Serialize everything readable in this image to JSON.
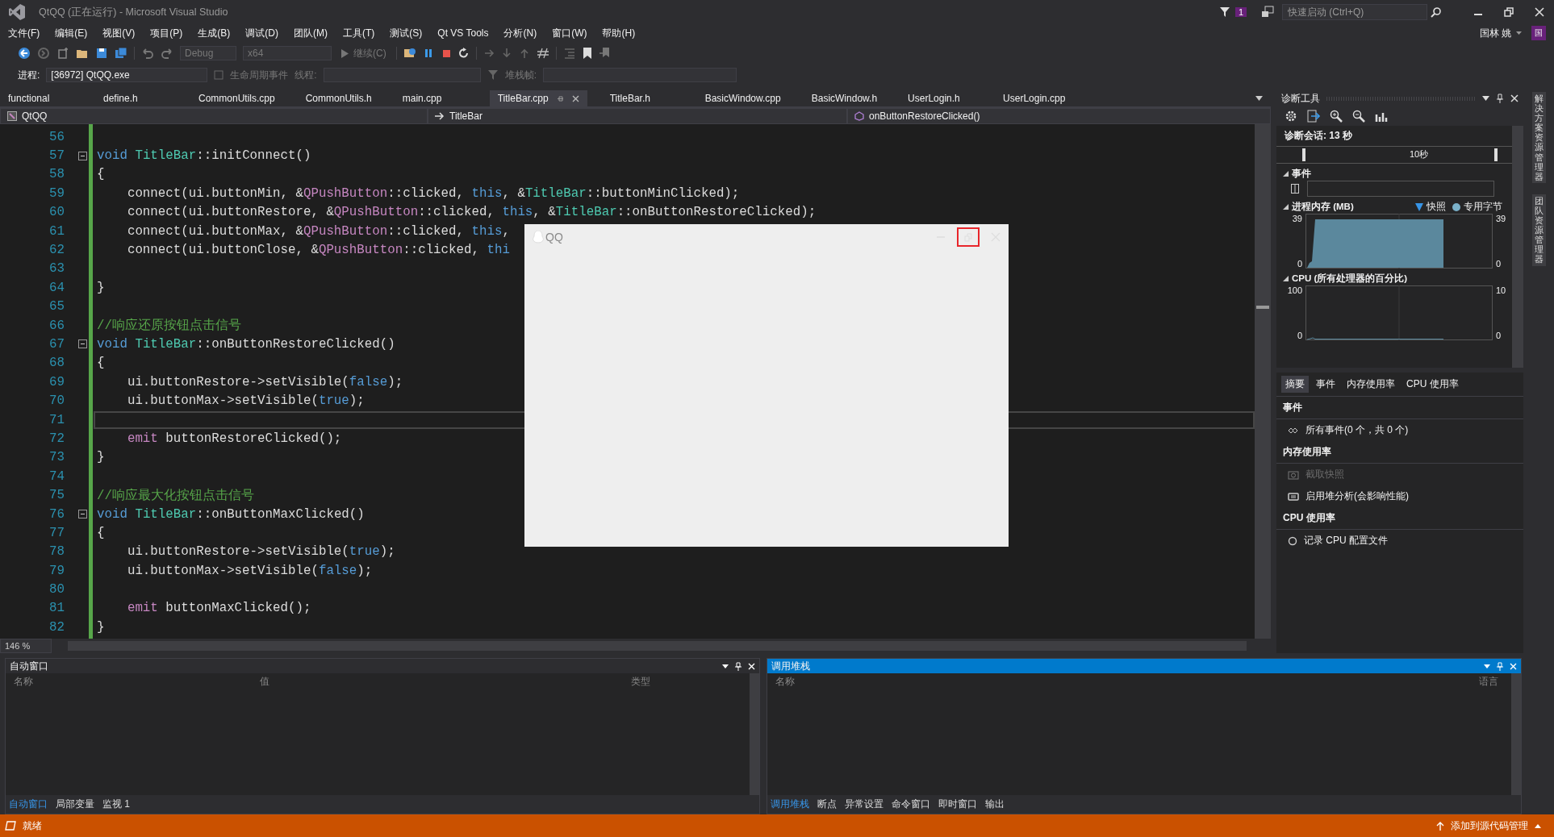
{
  "window": {
    "title": "QtQQ (正在运行) - Microsoft Visual Studio",
    "notification_count": "1",
    "quick_launch": {
      "placeholder": "快速启动 (Ctrl+Q)"
    },
    "user": "国林 姚",
    "avatar": "国"
  },
  "menu": [
    "文件(F)",
    "编辑(E)",
    "视图(V)",
    "项目(P)",
    "生成(B)",
    "调试(D)",
    "团队(M)",
    "工具(T)",
    "测试(S)",
    "Qt VS Tools",
    "分析(N)",
    "窗口(W)",
    "帮助(H)"
  ],
  "toolbar": {
    "configuration": "Debug",
    "platform": "x64",
    "continue": "继续(C)"
  },
  "debug_location": {
    "process_label": "进程:",
    "process": "[36972] QtQQ.exe",
    "lifecycle": "生命周期事件",
    "thread_label": "线程:",
    "stack_frame_label": "堆栈帧:"
  },
  "editor": {
    "tabs": [
      {
        "label": "functional",
        "selected": false
      },
      {
        "label": "define.h",
        "selected": false
      },
      {
        "label": "CommonUtils.cpp",
        "selected": false
      },
      {
        "label": "CommonUtils.h",
        "selected": false
      },
      {
        "label": "main.cpp",
        "selected": false
      },
      {
        "label": "TitleBar.cpp",
        "selected": true
      },
      {
        "label": "TitleBar.h",
        "selected": false
      },
      {
        "label": "BasicWindow.cpp",
        "selected": false
      },
      {
        "label": "BasicWindow.h",
        "selected": false
      },
      {
        "label": "UserLogin.h",
        "selected": false
      },
      {
        "label": "UserLogin.cpp",
        "selected": false
      }
    ],
    "nav": {
      "project": "QtQQ",
      "scope": "TitleBar",
      "member": "onButtonRestoreClicked()"
    },
    "lines": [
      {
        "number": "56",
        "collapsible": false,
        "current": false
      },
      {
        "number": "57",
        "collapsible": true,
        "current": false,
        "tokens": [
          {
            "kind": "keyword",
            "text": "void "
          },
          {
            "kind": "type",
            "text": "TitleBar"
          },
          {
            "kind": "plain",
            "text": "::initConnect()"
          }
        ]
      },
      {
        "number": "58",
        "collapsible": false,
        "current": false,
        "tokens": [
          {
            "kind": "plain",
            "text": "{"
          }
        ]
      },
      {
        "number": "59",
        "collapsible": false,
        "current": false,
        "indented": true,
        "tokens": [
          {
            "kind": "plain",
            "text": "connect(ui.buttonMin, &"
          },
          {
            "kind": "macro",
            "text": "QPushButton"
          },
          {
            "kind": "plain",
            "text": "::clicked, "
          },
          {
            "kind": "keyword",
            "text": "this"
          },
          {
            "kind": "plain",
            "text": ", &"
          },
          {
            "kind": "type",
            "text": "TitleBar"
          },
          {
            "kind": "plain",
            "text": "::buttonMinClicked);"
          }
        ]
      },
      {
        "number": "60",
        "collapsible": false,
        "current": false,
        "indented": true,
        "tokens": [
          {
            "kind": "plain",
            "text": "connect(ui.buttonRestore, &"
          },
          {
            "kind": "macro",
            "text": "QPushButton"
          },
          {
            "kind": "plain",
            "text": "::clicked, "
          },
          {
            "kind": "keyword",
            "text": "this"
          },
          {
            "kind": "plain",
            "text": ", &"
          },
          {
            "kind": "type",
            "text": "TitleBar"
          },
          {
            "kind": "plain",
            "text": "::onButtonRestoreClicked);"
          }
        ]
      },
      {
        "number": "61",
        "collapsible": false,
        "current": false,
        "indented": true,
        "tokens": [
          {
            "kind": "plain",
            "text": "connect(ui.buttonMax, &"
          },
          {
            "kind": "macro",
            "text": "QPushButton"
          },
          {
            "kind": "plain",
            "text": "::clicked, "
          },
          {
            "kind": "keyword",
            "text": "this"
          },
          {
            "kind": "plain",
            "text": ","
          }
        ]
      },
      {
        "number": "62",
        "collapsible": false,
        "current": false,
        "indented": true,
        "tokens": [
          {
            "kind": "plain",
            "text": "connect(ui.buttonClose, &"
          },
          {
            "kind": "macro",
            "text": "QPushButton"
          },
          {
            "kind": "plain",
            "text": "::clicked, "
          },
          {
            "kind": "keyword",
            "text": "thi"
          }
        ]
      },
      {
        "number": "63",
        "collapsible": false,
        "current": false
      },
      {
        "number": "64",
        "collapsible": false,
        "current": false,
        "tokens": [
          {
            "kind": "plain",
            "text": "}"
          }
        ]
      },
      {
        "number": "65",
        "collapsible": false,
        "current": false
      },
      {
        "number": "66",
        "collapsible": false,
        "current": false,
        "tokens": [
          {
            "kind": "comment",
            "text": "//响应还原按钮点击信号"
          }
        ]
      },
      {
        "number": "67",
        "collapsible": true,
        "current": false,
        "tokens": [
          {
            "kind": "keyword",
            "text": "void "
          },
          {
            "kind": "type",
            "text": "TitleBar"
          },
          {
            "kind": "plain",
            "text": "::onButtonRestoreClicked()"
          }
        ]
      },
      {
        "number": "68",
        "collapsible": false,
        "current": false,
        "tokens": [
          {
            "kind": "plain",
            "text": "{"
          }
        ]
      },
      {
        "number": "69",
        "collapsible": false,
        "current": false,
        "indented": true,
        "tokens": [
          {
            "kind": "plain",
            "text": "ui.buttonRestore->setVisible("
          },
          {
            "kind": "keyword",
            "text": "false"
          },
          {
            "kind": "plain",
            "text": ");"
          }
        ]
      },
      {
        "number": "70",
        "collapsible": false,
        "current": false,
        "indented": true,
        "tokens": [
          {
            "kind": "plain",
            "text": "ui.buttonMax->setVisible("
          },
          {
            "kind": "keyword",
            "text": "true"
          },
          {
            "kind": "plain",
            "text": ");"
          }
        ]
      },
      {
        "number": "71",
        "collapsible": false,
        "current": true
      },
      {
        "number": "72",
        "collapsible": false,
        "current": false,
        "indented": true,
        "tokens": [
          {
            "kind": "macro",
            "text": "emit"
          },
          {
            "kind": "plain",
            "text": " buttonRestoreClicked();"
          }
        ]
      },
      {
        "number": "73",
        "collapsible": false,
        "current": false,
        "tokens": [
          {
            "kind": "plain",
            "text": "}"
          }
        ]
      },
      {
        "number": "74",
        "collapsible": false,
        "current": false
      },
      {
        "number": "75",
        "collapsible": false,
        "current": false,
        "tokens": [
          {
            "kind": "comment",
            "text": "//响应最大化按钮点击信号"
          }
        ]
      },
      {
        "number": "76",
        "collapsible": true,
        "current": false,
        "tokens": [
          {
            "kind": "keyword",
            "text": "void "
          },
          {
            "kind": "type",
            "text": "TitleBar"
          },
          {
            "kind": "plain",
            "text": "::onButtonMaxClicked()"
          }
        ]
      },
      {
        "number": "77",
        "collapsible": false,
        "current": false,
        "tokens": [
          {
            "kind": "plain",
            "text": "{"
          }
        ]
      },
      {
        "number": "78",
        "collapsible": false,
        "current": false,
        "indented": true,
        "tokens": [
          {
            "kind": "plain",
            "text": "ui.buttonRestore->setVisible("
          },
          {
            "kind": "keyword",
            "text": "true"
          },
          {
            "kind": "plain",
            "text": ");"
          }
        ]
      },
      {
        "number": "79",
        "collapsible": false,
        "current": false,
        "indented": true,
        "tokens": [
          {
            "kind": "plain",
            "text": "ui.buttonMax->setVisible("
          },
          {
            "kind": "keyword",
            "text": "false"
          },
          {
            "kind": "plain",
            "text": ");"
          }
        ]
      },
      {
        "number": "80",
        "collapsible": false,
        "current": false
      },
      {
        "number": "81",
        "collapsible": false,
        "current": false,
        "indented": true,
        "tokens": [
          {
            "kind": "macro",
            "text": "emit"
          },
          {
            "kind": "plain",
            "text": " buttonMaxClicked();"
          }
        ]
      },
      {
        "number": "82",
        "collapsible": false,
        "current": false,
        "tokens": [
          {
            "kind": "plain",
            "text": "}"
          }
        ]
      }
    ],
    "zoom": "146 %"
  },
  "qq_window": {
    "title": "QQ"
  },
  "diagnostics": {
    "title": "诊断工具",
    "session": "诊断会话: 13 秒",
    "timeline_label": "10秒",
    "events_title": "事件",
    "memory": {
      "title": "进程内存 (MB)",
      "legend": [
        {
          "label": "快照",
          "kind": "triangle",
          "color": "#3794e6"
        },
        {
          "label": "专用字节",
          "kind": "dot",
          "color": "#7ab0c9"
        }
      ],
      "left_axis": [
        "39",
        "0"
      ],
      "right_axis": [
        "39",
        "0"
      ]
    },
    "cpu": {
      "title": "CPU (所有处理器的百分比)",
      "left_axis": [
        "100",
        "0"
      ],
      "right_axis": [
        "10",
        "0"
      ]
    },
    "tabs": [
      {
        "label": "摘要",
        "selected": true
      },
      {
        "label": "事件",
        "selected": false
      },
      {
        "label": "内存使用率",
        "selected": false
      },
      {
        "label": "CPU 使用率",
        "selected": false
      }
    ],
    "sections": [
      {
        "title": "事件",
        "items": [
          {
            "kind": "events",
            "label": "所有事件(0 个，共 0 个)",
            "disabled": false
          }
        ]
      },
      {
        "title": "内存使用率",
        "items": [
          {
            "kind": "snapshot",
            "label": "截取快照",
            "disabled": true
          },
          {
            "kind": "heap",
            "label": "启用堆分析(会影响性能)",
            "disabled": false
          }
        ]
      },
      {
        "title": "CPU 使用率",
        "items": [
          {
            "kind": "record",
            "label": "记录 CPU 配置文件",
            "disabled": false
          }
        ]
      }
    ]
  },
  "side_tabs": [
    "解决方案资源管理器",
    "团队资源管理器"
  ],
  "autos": {
    "title": "自动窗口",
    "active": false,
    "columns": [
      "名称",
      "值",
      "类型"
    ],
    "tabs": [
      {
        "label": "自动窗口",
        "selected": true
      },
      {
        "label": "局部变量",
        "selected": false
      },
      {
        "label": "监视 1",
        "selected": false
      }
    ]
  },
  "call_stack": {
    "title": "调用堆栈",
    "active": true,
    "columns": [
      "名称",
      "语言"
    ],
    "tabs": [
      {
        "label": "调用堆栈",
        "selected": true
      },
      {
        "label": "断点",
        "selected": false
      },
      {
        "label": "异常设置",
        "selected": false
      },
      {
        "label": "命令窗口",
        "selected": false
      },
      {
        "label": "即时窗口",
        "selected": false
      },
      {
        "label": "输出",
        "selected": false
      }
    ]
  },
  "status_bar": {
    "text": "就绪",
    "source_control": "添加到源代码管理"
  }
}
